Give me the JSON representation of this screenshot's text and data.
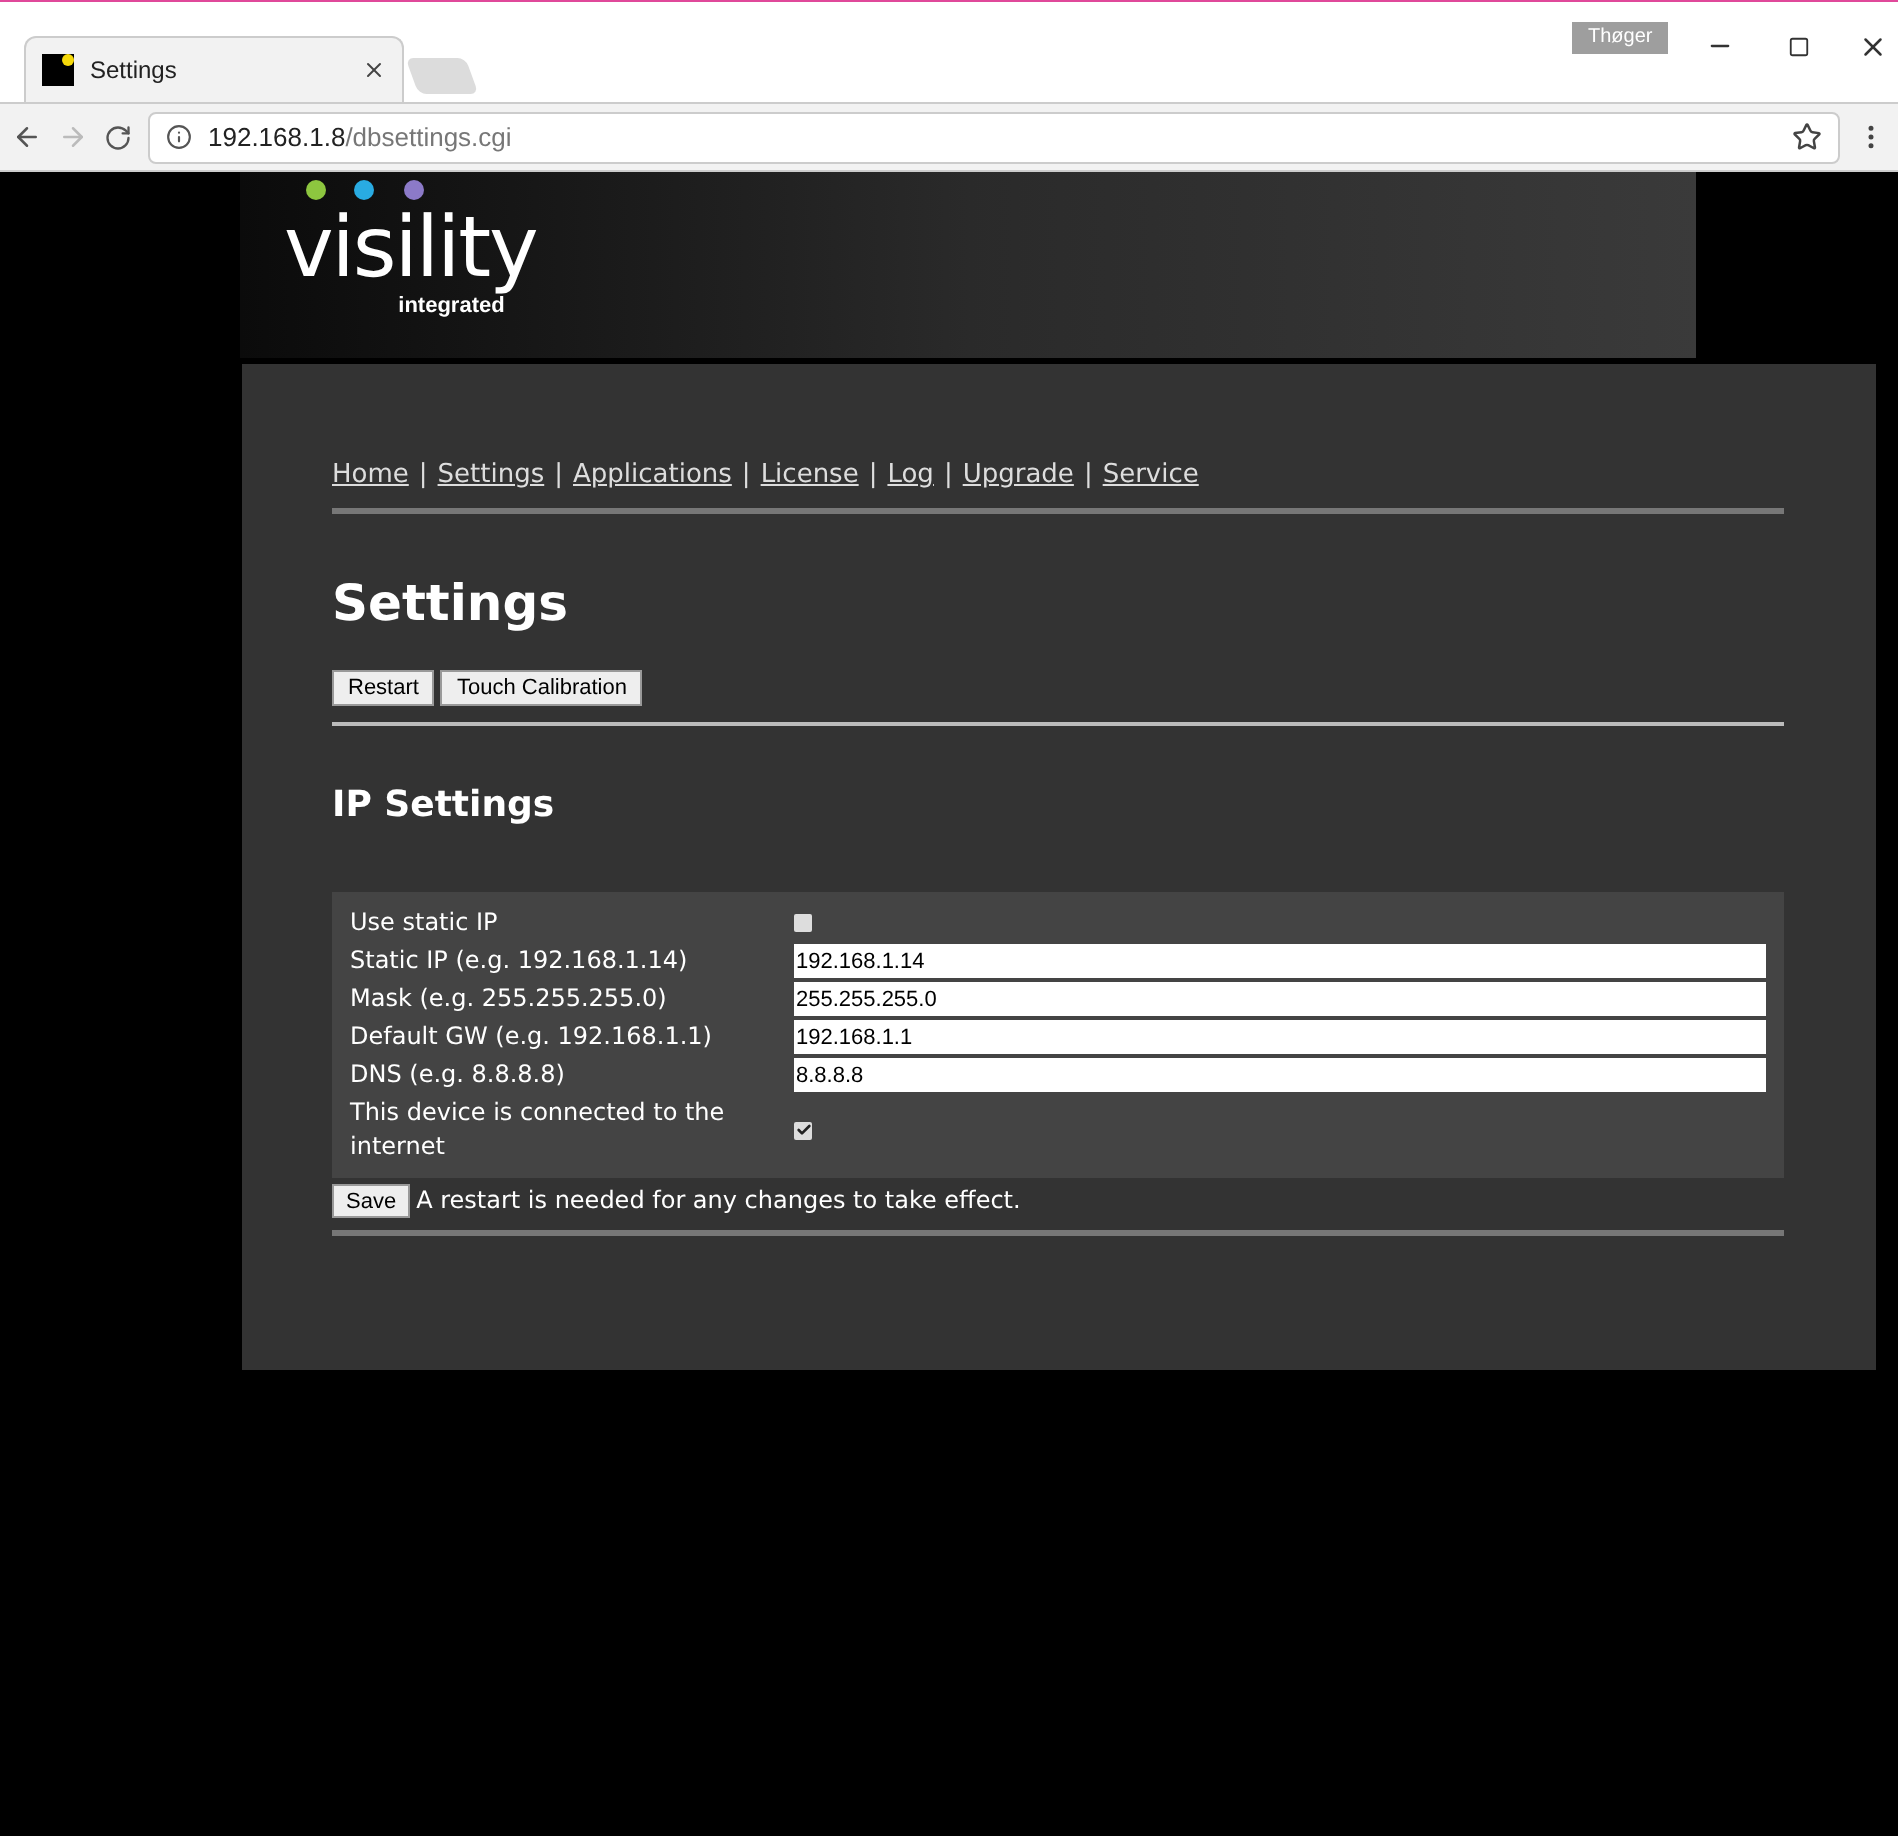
{
  "browser": {
    "profile": "Thøger",
    "tab": {
      "title": "Settings"
    },
    "address": {
      "host": "192.168.1.8",
      "path": "/dbsettings.cgi"
    }
  },
  "logo": {
    "wordmark": "visility",
    "tagline": "integrated"
  },
  "nav": [
    "Home",
    "Settings",
    "Applications",
    "License",
    "Log",
    "Upgrade",
    "Service"
  ],
  "nav_separator": "|",
  "title": "Settings",
  "actions": [
    "Restart",
    "Touch Calibration"
  ],
  "section": "IP Settings",
  "rows": [
    {
      "kind": "checkbox",
      "label": "Use static IP",
      "checked": false
    },
    {
      "kind": "text",
      "label": "Static IP (e.g. 192.168.1.14)",
      "value": "192.168.1.14"
    },
    {
      "kind": "text",
      "label": "Mask (e.g. 255.255.255.0)",
      "value": "255.255.255.0"
    },
    {
      "kind": "text",
      "label": "Default GW (e.g. 192.168.1.1)",
      "value": "192.168.1.1"
    },
    {
      "kind": "text",
      "label": "DNS (e.g. 8.8.8.8)",
      "value": "8.8.8.8"
    },
    {
      "kind": "checkbox",
      "label": "This device is connected to the internet",
      "checked": true
    }
  ],
  "save": {
    "button": "Save",
    "note": "A restart is needed for any changes to take effect."
  }
}
